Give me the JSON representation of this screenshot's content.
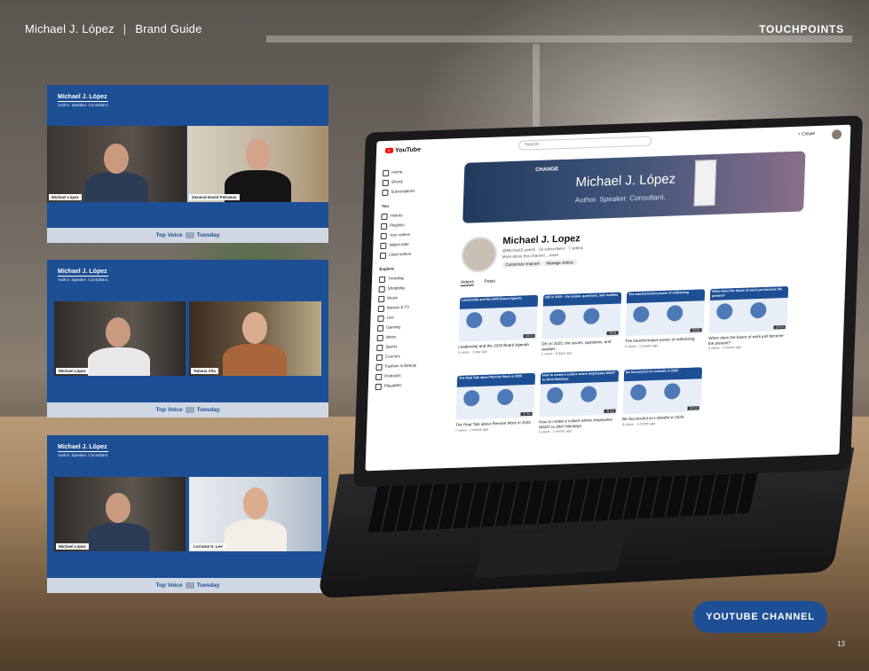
{
  "header": {
    "author": "Michael J. López",
    "separator": "|",
    "doc_title": "Brand Guide",
    "section": "TOUCHPOINTS"
  },
  "cards": [
    {
      "brand_name": "Michael J. López",
      "brand_tagline": "Author. Speaker. Consultant.",
      "footer_left": "Top Voice",
      "footer_right": "Tuesday",
      "guests": [
        {
          "name": "Michael López"
        },
        {
          "name": "General David Petraeus"
        }
      ]
    },
    {
      "brand_name": "Michael J. López",
      "brand_tagline": "Author. Speaker. Consultant.",
      "footer_left": "Top Voice",
      "footer_right": "Tuesday",
      "guests": [
        {
          "name": "Michael López"
        },
        {
          "name": "Tatiana Vita"
        }
      ]
    },
    {
      "brand_name": "Michael J. López",
      "brand_tagline": "Author. Speaker. Consultant.",
      "footer_left": "Top Voice",
      "footer_right": "Tuesday",
      "guests": [
        {
          "name": "Michael López"
        },
        {
          "name": "Lorraine K. Lee"
        }
      ]
    }
  ],
  "youtube": {
    "logo": "YouTube",
    "search_placeholder": "Search",
    "create_label": "+ Create",
    "sidebar": [
      "Home",
      "Shorts",
      "Subscriptions",
      "You",
      "History",
      "Playlists",
      "Your videos",
      "Watch later",
      "Liked videos",
      "Explore",
      "Trending",
      "Shopping",
      "Music",
      "Movies & TV",
      "Live",
      "Gaming",
      "News",
      "Sports",
      "Courses",
      "Fashion & Beauty",
      "Podcasts",
      "Playables"
    ],
    "banner_name": "Michael J. López",
    "banner_tagline": "Author. Speaker. Consultant.",
    "banner_book": "CHANGE",
    "channel_name": "Michael J. Lopez",
    "channel_handle": "@MichaelJLopez5 · 59 subscribers · 7 videos",
    "channel_desc": "More about this channel ...more",
    "btn_customize": "Customize channel",
    "btn_manage": "Manage videos",
    "tabs": [
      "Videos",
      "Posts"
    ],
    "videos": [
      {
        "title": "Leadership and the 2025 Board Agenda",
        "thumb": "Leadership and the 2025 Board Agenda",
        "duration": "34:13",
        "meta": "6 views · 1 day ago"
      },
      {
        "title": "DEI in 2025: the issues, questions, and realities",
        "thumb": "DEI in 2025 - the issues, questions, and realities",
        "duration": "30:01",
        "meta": "2 views · 6 days ago"
      },
      {
        "title": "The transformative power of redirecting",
        "thumb": "The transformative power of redirecting",
        "duration": "20:50",
        "meta": "5 views · 2 weeks ago"
      },
      {
        "title": "When does the future of work just become the present?",
        "thumb": "When does the future of work just become the present?",
        "duration": "29:19",
        "meta": "4 views · 3 weeks ago"
      },
      {
        "title": "The Real Talk about Remote Work in 2025",
        "thumb": "The Real Talk about Remote Work in 2025",
        "duration": "27:16",
        "meta": "7 views · 1 month ago"
      },
      {
        "title": "How to create a culture where employees WANT to ditch Mondays",
        "thumb": "How to create a culture where employees WANT to ditch Mondays",
        "duration": "31:13",
        "meta": "5 views · 1 month ago"
      },
      {
        "title": "Be Successful on LinkedIn in 2025",
        "thumb": "Be Successful on LinkedIn in 2025",
        "duration": "34:13",
        "meta": "8 views · 1 month ago"
      }
    ]
  },
  "cta": {
    "label": "YOUTUBE CHANNEL"
  },
  "page_number": "13",
  "colors": {
    "brand_blue": "#1d4f95",
    "footer_gray": "#cfd7e2",
    "youtube_red": "#ff0000"
  }
}
